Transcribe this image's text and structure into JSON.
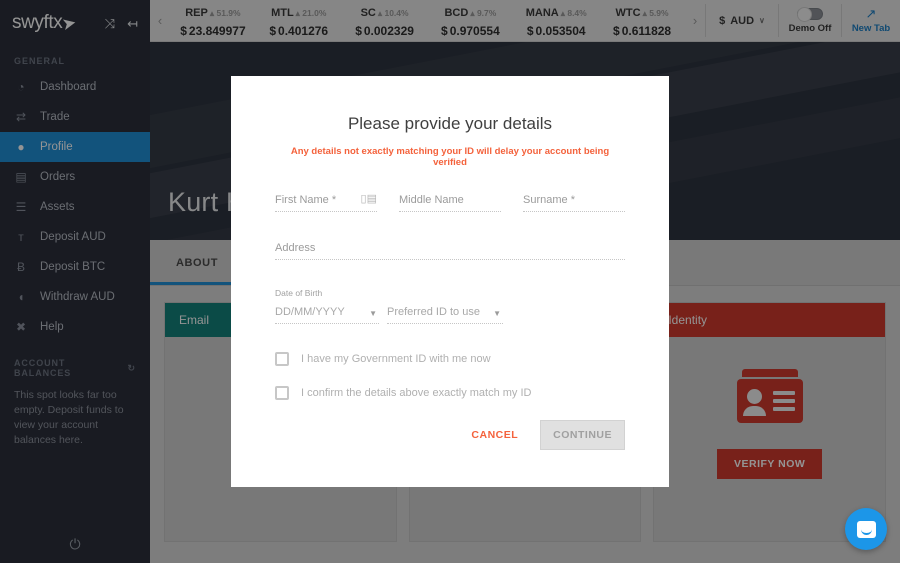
{
  "sidebar": {
    "brand": "swyftx",
    "brand_icons": [
      {
        "name": "expand-icon",
        "glyph": "⤨"
      },
      {
        "name": "collapse-sidebar-icon",
        "glyph": "↤"
      }
    ],
    "section_label": "GENERAL",
    "items": [
      {
        "label": "Dashboard",
        "icon": "speedometer-icon",
        "glyph": "◔",
        "active": false
      },
      {
        "label": "Trade",
        "icon": "exchange-icon",
        "glyph": "⇄",
        "active": false
      },
      {
        "label": "Profile",
        "icon": "user-icon",
        "glyph": "●",
        "active": true
      },
      {
        "label": "Orders",
        "icon": "calculator-icon",
        "glyph": "▤",
        "active": false
      },
      {
        "label": "Assets",
        "icon": "list-icon",
        "glyph": "☰",
        "active": false
      },
      {
        "label": "Deposit AUD",
        "icon": "bank-icon",
        "glyph": "ᴛ",
        "active": false
      },
      {
        "label": "Deposit BTC",
        "icon": "bitcoin-icon",
        "glyph": "Ƀ",
        "active": false
      },
      {
        "label": "Withdraw AUD",
        "icon": "piggy-bank-icon",
        "glyph": "◖",
        "active": false
      },
      {
        "label": "Help",
        "icon": "help-icon",
        "glyph": "✖",
        "active": false
      }
    ],
    "balances_label": "ACCOUNT BALANCES",
    "refresh_icon": "refresh-icon",
    "balances_empty_text": "This spot looks far too empty. Deposit funds to view your account balances here.",
    "power_icon": "power-icon"
  },
  "topbar": {
    "prev_arrow": "‹",
    "next_arrow": "›",
    "tickers": [
      {
        "symbol": "REP",
        "change": "▴ 51.9%",
        "currency": "$",
        "price": "23.849977"
      },
      {
        "symbol": "MTL",
        "change": "▴ 21.0%",
        "currency": "$",
        "price": "0.401276"
      },
      {
        "symbol": "SC",
        "change": "▴ 10.4%",
        "currency": "$",
        "price": "0.002329"
      },
      {
        "symbol": "BCD",
        "change": "▴ 9.7%",
        "currency": "$",
        "price": "0.970554"
      },
      {
        "symbol": "MANA",
        "change": "▴ 8.4%",
        "currency": "$",
        "price": "0.053504"
      },
      {
        "symbol": "WTC",
        "change": "▴ 5.9%",
        "currency": "$",
        "price": "0.611828"
      }
    ],
    "currency_symbol": "$",
    "currency_value": "AUD",
    "currency_caret": "∨",
    "demo_label": "Demo Off",
    "new_tab_label": "New Tab",
    "new_tab_icon": "external-link-icon"
  },
  "page": {
    "profile_name": "Kurt Ho",
    "tabs": [
      {
        "label": "ABOUT",
        "active": true
      }
    ],
    "cards": [
      {
        "title": "Email",
        "color": "#13827a",
        "name": "email-card"
      },
      {
        "title": "",
        "color": "#cfcfcf",
        "name": "middle-card"
      },
      {
        "title": "Identity",
        "color": "#cf3a2d",
        "name": "identity-card",
        "icon": "id-card-icon",
        "button_label": "VERIFY NOW",
        "button_color": "#cf3a2d"
      }
    ]
  },
  "modal": {
    "title": "Please provide your details",
    "warning": "Any details not exactly matching your ID will delay your account being verified",
    "warning_color": "#f4623c",
    "fields": {
      "first_name": {
        "label": "First Name *",
        "value": "",
        "icon": "contact-card-icon"
      },
      "middle_name": {
        "label": "Middle Name",
        "value": ""
      },
      "surname": {
        "label": "Surname *",
        "value": ""
      },
      "address": {
        "label": "Address",
        "value": ""
      },
      "dob_label": "Date of Birth",
      "dob": {
        "placeholder": "DD/MM/YYYY",
        "value": ""
      },
      "preferred_id": {
        "placeholder": "Preferred ID to use",
        "value": ""
      }
    },
    "checkboxes": [
      {
        "label": "I have my Government ID with me now",
        "checked": false
      },
      {
        "label": "I confirm the details above exactly match my ID",
        "checked": false
      }
    ],
    "cancel_label": "CANCEL",
    "continue_label": "CONTINUE"
  },
  "chat": {
    "icon": "chat-bubble-icon"
  }
}
